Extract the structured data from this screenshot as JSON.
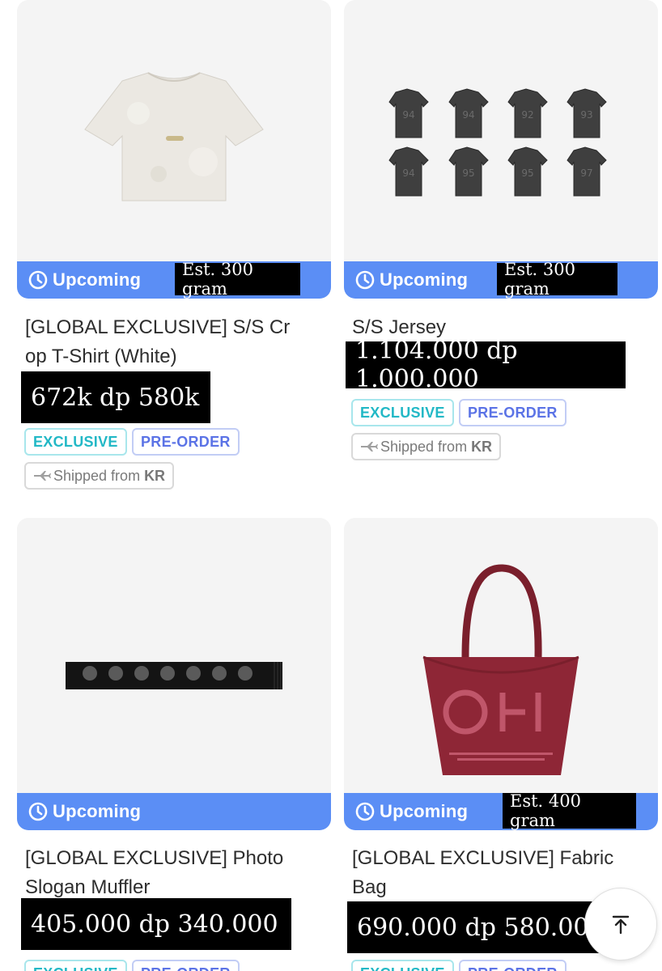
{
  "status_label": "Upcoming",
  "tags": {
    "exclusive": "EXCLUSIVE",
    "preorder": "PRE-ORDER",
    "shipped_prefix": "Shipped from",
    "shipped_country": "KR"
  },
  "products": [
    {
      "title_line1": "[GLOBAL EXCLUSIVE] S/S Cr",
      "title_line2": "op T-Shirt (White)",
      "weight": "Est. 300 gram",
      "price": "672k dp 580k"
    },
    {
      "title_line1": "S/S Jersey",
      "weight": "Est. 300 gram",
      "price": "1.104.000 dp 1.000.000"
    },
    {
      "title_line1": "[GLOBAL EXCLUSIVE] Photo",
      "title_line2": "Slogan Muffler",
      "price": "405.000 dp 340.000"
    },
    {
      "title_line1": "[GLOBAL EXCLUSIVE] Fabric",
      "title_line2": "Bag",
      "weight": "Est. 400 gram",
      "price": "690.000 dp 580.000"
    }
  ],
  "colors": {
    "status_bar": "#5b8ef5",
    "exclusive": "#22b8c6",
    "preorder": "#5b73e6"
  }
}
